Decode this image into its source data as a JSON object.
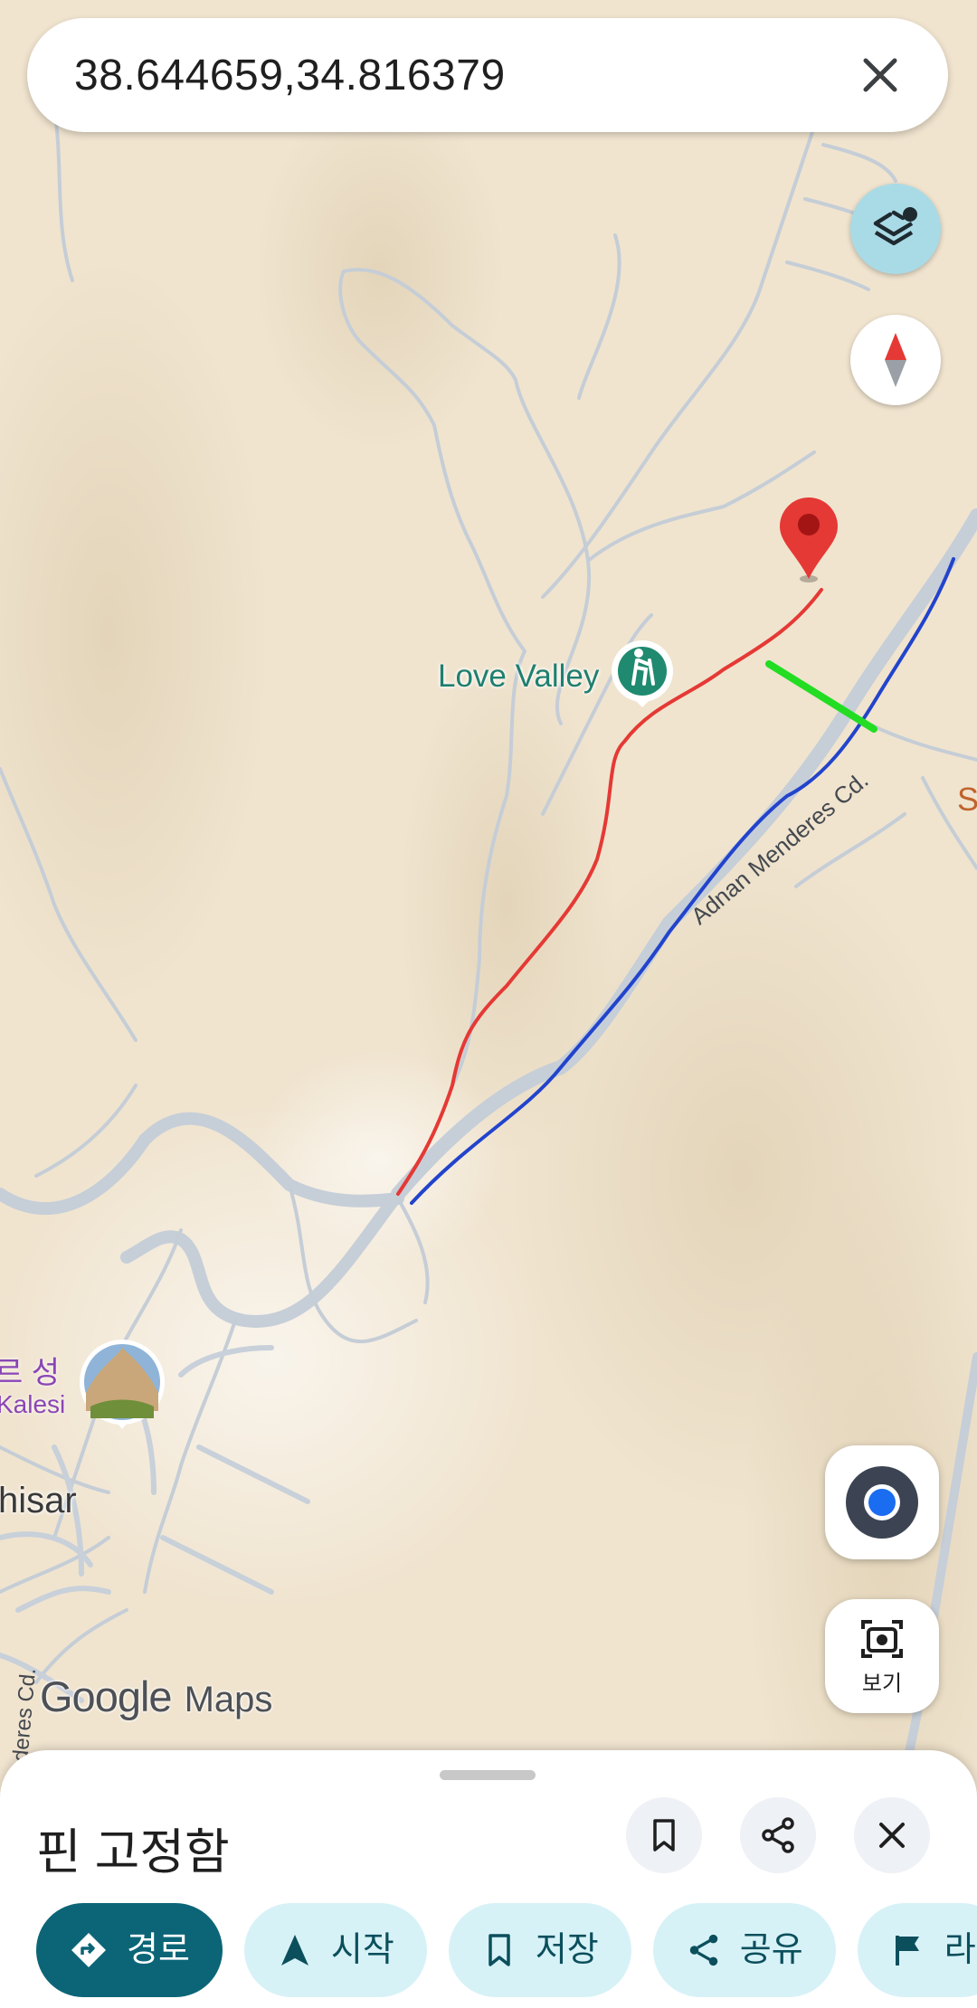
{
  "search": {
    "query": "38.644659,34.816379"
  },
  "map": {
    "labels": {
      "love_valley": "Love Valley",
      "castle_ko": "르 성",
      "castle_en": "Kalesi",
      "town": "hisar",
      "edge": "S",
      "road": "Adnan Menderes Cd.",
      "road_vertical": "nderes Cd."
    },
    "pin_color": "#e53935",
    "route_colors": {
      "red": "#e53935",
      "blue": "#2244cc",
      "green": "#22dd22"
    },
    "poi_color": "#1f8a70"
  },
  "controls": {
    "layers_icon": "layers-icon",
    "compass_icon": "compass-icon",
    "location_icon": "my-location-icon",
    "lens_label": "보기"
  },
  "watermark": {
    "google": "Google",
    "maps": "Maps"
  },
  "sheet": {
    "title": "핀 고정함",
    "chips": {
      "directions": "경로",
      "start": "시작",
      "save": "저장",
      "share": "공유",
      "label": "라"
    }
  }
}
